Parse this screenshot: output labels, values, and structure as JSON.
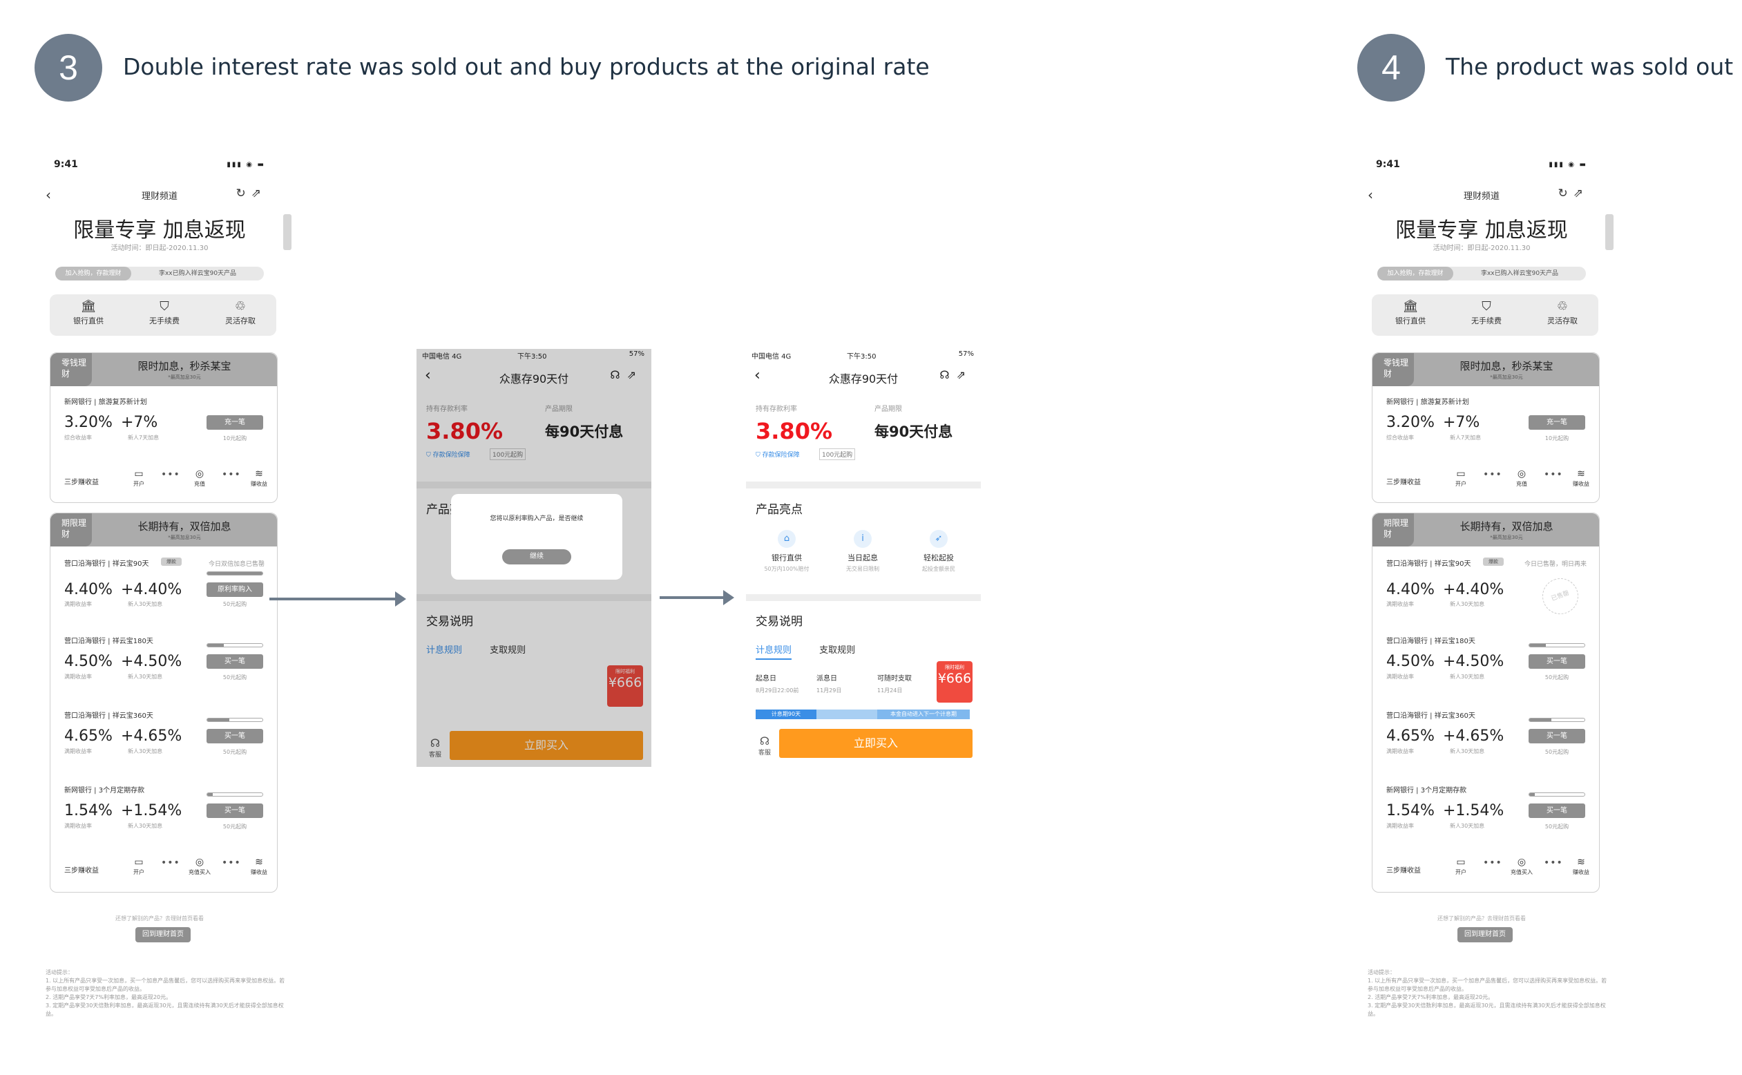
{
  "steps": {
    "left": {
      "number": "3",
      "title": "Double interest rate was sold out and buy products at the original rate"
    },
    "right": {
      "number": "4",
      "title": "The product was sold out"
    }
  },
  "phone": {
    "time": "9:41",
    "nav_title": "理财频道",
    "headline": "限量专享 加息返现",
    "activity_time": "活动时间：即日起-2020.11.30",
    "tab_a": "加入抢购，存款理财",
    "tab_b": "李xx已购入祥云宝90天产品",
    "features": [
      "银行直供",
      "无手续费",
      "灵活存取"
    ],
    "card1": {
      "tag": "零钱理财",
      "title": "限时加息，秒杀某宝",
      "sub": "*最高加息30元",
      "product": {
        "name": "新网银行 | 旅游复苏新计划",
        "rate": "3.20%",
        "bonus": "+7%",
        "rate_label": "综合收益率",
        "bonus_label": "新人7天加息",
        "button": "充一笔",
        "min": "10元起购"
      },
      "steps_label": "三步赚收益",
      "step_items": [
        "开户",
        "充值",
        "赚收益"
      ]
    },
    "card2": {
      "tag": "期限理财",
      "title": "长期持有，双倍加息",
      "sub": "*最高加息30元",
      "products": [
        {
          "name": "营口沿海银行 | 祥云宝90天",
          "badge": "爆款",
          "note": "今日双倍加息已售罄",
          "rate": "4.40%",
          "bonus": "+4.40%",
          "rate_label": "满期收益率",
          "bonus_label": "新人30天加息",
          "button": "原利率购入",
          "min": "50元起购",
          "progress": 1.0
        },
        {
          "name": "营口沿海银行 | 祥云宝180天",
          "rate": "4.50%",
          "bonus": "+4.50%",
          "rate_label": "满期收益率",
          "bonus_label": "新人30天加息",
          "button": "买一笔",
          "min": "50元起购",
          "progress": 0.3
        },
        {
          "name": "营口沿海银行 | 祥云宝360天",
          "rate": "4.65%",
          "bonus": "+4.65%",
          "rate_label": "满期收益率",
          "bonus_label": "新人30天加息",
          "button": "买一笔",
          "min": "50元起购",
          "progress": 0.4
        },
        {
          "name": "新网银行 | 3个月定期存款",
          "rate": "1.54%",
          "bonus": "+1.54%",
          "rate_label": "满期收益率",
          "bonus_label": "新人30天加息",
          "button": "买一笔",
          "min": "50元起购",
          "progress": 0.1
        }
      ],
      "steps_label": "三步赚收益",
      "step_items": [
        "开户",
        "充值买入",
        "赚收益"
      ]
    },
    "footer_question": "还想了解别的产品？去理财首页看看",
    "footer_button": "回到理财首页",
    "notes": "活动提示：\n1. 以上所有产品只享受一次加息，买一个加息产品售馨后，您可以选择购买再来享受加息权益。若参与加息权益可享受加息后产品的收益。\n2. 活期产品享受7天7%利率加息，最高返现20元。\n3. 定期产品享受30天倍数利率加息，最高返现30元，且需连续持有满30天后才能获得全部加息权益。",
    "right_card2_note": "今日已售罄，明日再来",
    "sold_out_stamp": "已售罄"
  },
  "detail": {
    "carrier": "中国电信  4G",
    "time": "下午3:50",
    "battery": "57%",
    "title": "众惠存90天付",
    "rate_label": "持有存款利率",
    "rate": "3.80%",
    "term_label": "产品期限",
    "term": "每90天付息",
    "tag_protect": "存款保险保障",
    "tag_min": "100元起购",
    "highlights_title": "产品亮点",
    "highlights": [
      {
        "t": "银行直供",
        "s": "50万内100%赔付"
      },
      {
        "t": "当日起息",
        "s": "无交易日限制"
      },
      {
        "t": "轻松起投",
        "s": "起投金额亲民"
      }
    ],
    "trade_title": "交易说明",
    "tabs": [
      "计息规则",
      "支取规则"
    ],
    "timeline": [
      {
        "t": "起息日",
        "d": "8月29日22:00前"
      },
      {
        "t": "派息日",
        "d": "11月29日"
      },
      {
        "t": "可随时支取",
        "d": "11月24日"
      }
    ],
    "bar_left": "计息期90天",
    "bar_right": "本金自动进入下一个计息期",
    "promo_label": "限时福利",
    "promo_value": "¥666",
    "kefu": "客服",
    "buy": "立即买入",
    "modal_text": "您将以原利率购入产品，是否继续",
    "modal_button": "继续"
  }
}
